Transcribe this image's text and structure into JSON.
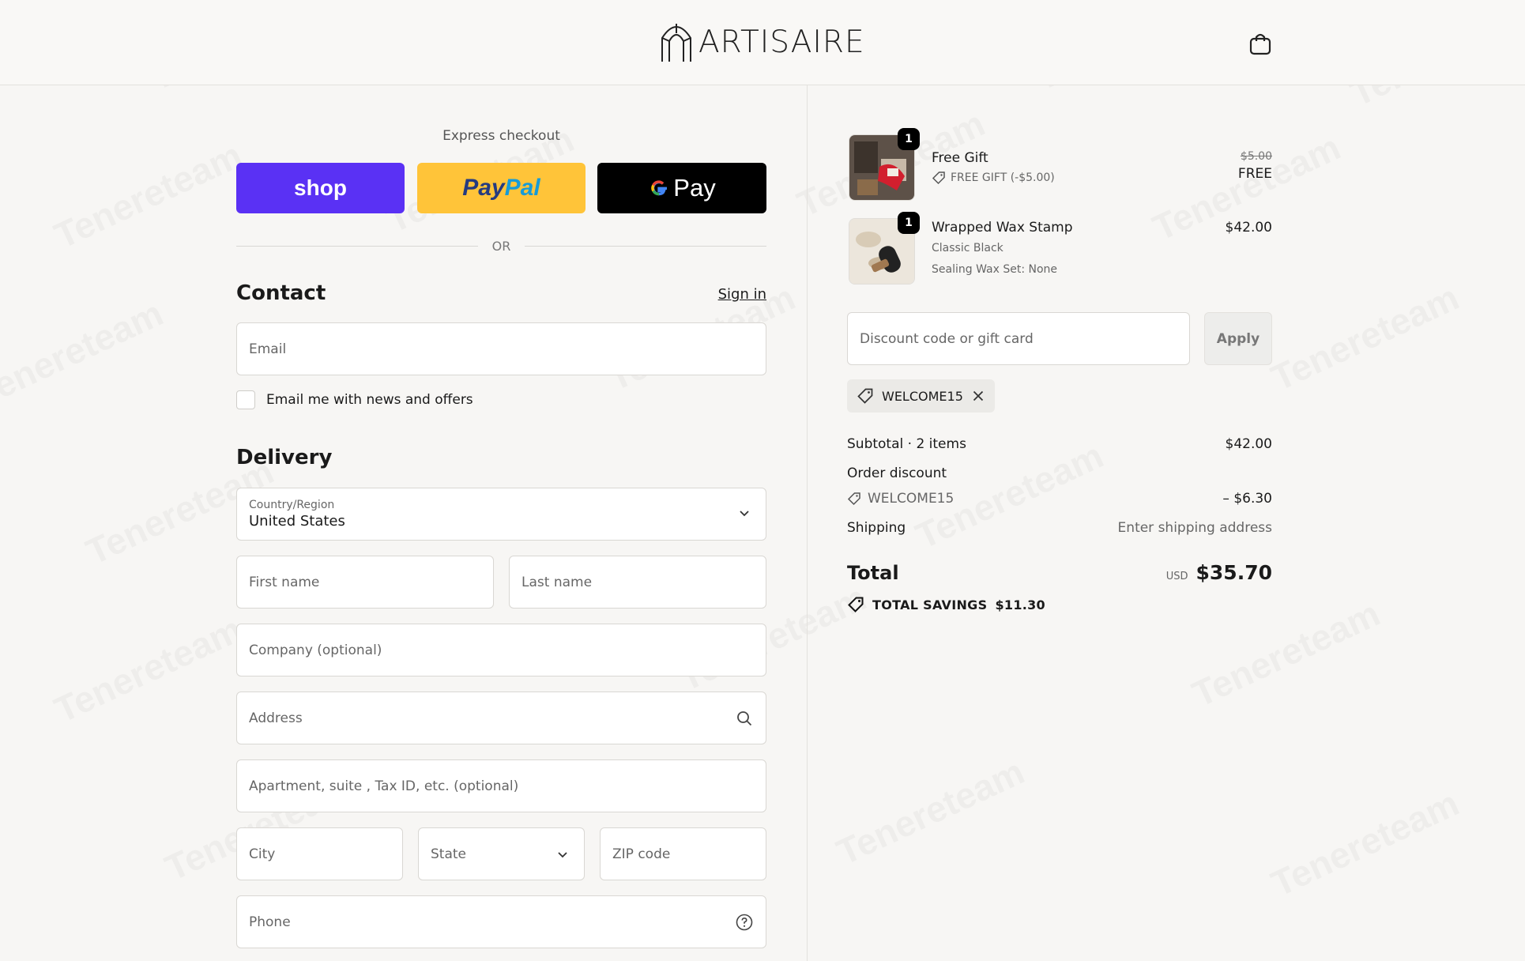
{
  "brand": {
    "name": "ARTISAIRE"
  },
  "express": {
    "title": "Express checkout",
    "shop_label": "shop",
    "paypal_part1": "Pay",
    "paypal_part2": "Pal",
    "gpay_label": "Pay",
    "or_label": "OR"
  },
  "contact": {
    "title": "Contact",
    "signin_label": "Sign in",
    "email_placeholder": "Email",
    "newsletter_label": "Email me with news and offers"
  },
  "delivery": {
    "title": "Delivery",
    "country_label": "Country/Region",
    "country_value": "United States",
    "first_name": "First name",
    "last_name": "Last name",
    "company": "Company (optional)",
    "address": "Address",
    "apartment": "Apartment, suite , Tax ID, etc. (optional)",
    "city": "City",
    "state": "State",
    "zip": "ZIP code",
    "phone": "Phone"
  },
  "cart": {
    "items": [
      {
        "qty": "1",
        "name": "Free Gift",
        "sub": "FREE GIFT (-$5.00)",
        "original_price": "$5.00",
        "price": "FREE"
      },
      {
        "qty": "1",
        "name": "Wrapped Wax Stamp",
        "variant": "Classic Black",
        "option": "Sealing Wax Set: None",
        "price": "$42.00"
      }
    ]
  },
  "discount": {
    "placeholder": "Discount code or gift card",
    "apply_label": "Apply",
    "applied_code": "WELCOME15"
  },
  "summary": {
    "subtotal_label": "Subtotal · 2 items",
    "subtotal_value": "$42.00",
    "order_discount_label": "Order discount",
    "discount_code": "WELCOME15",
    "discount_value": "– $6.30",
    "shipping_label": "Shipping",
    "shipping_value": "Enter shipping address",
    "total_label": "Total",
    "currency": "USD",
    "total_value": "$35.70",
    "savings_label": "TOTAL SAVINGS",
    "savings_value": "$11.30"
  }
}
